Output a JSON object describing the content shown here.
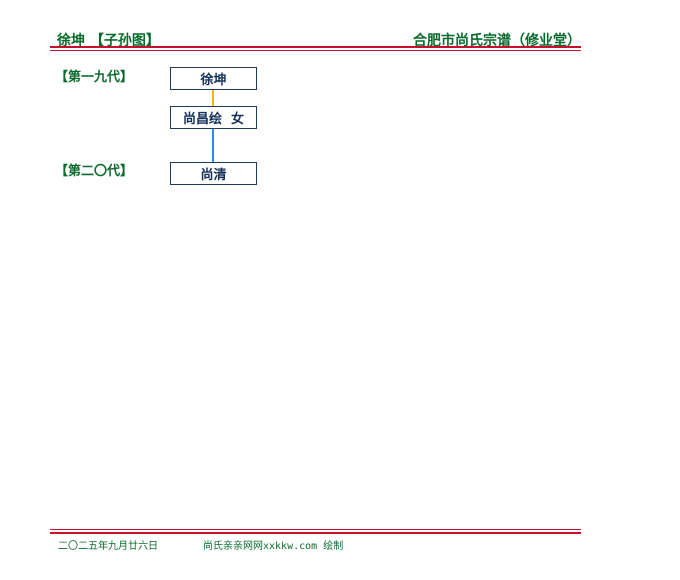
{
  "header": {
    "left_title": "徐坤 【子孙图】",
    "right_title": "合肥市尚氏宗谱（修业堂）"
  },
  "generations": [
    {
      "label": "【第一九代】"
    },
    {
      "label": "【第二〇代】"
    }
  ],
  "persons": [
    {
      "name": "徐坤"
    },
    {
      "name": "尚昌绘  女"
    },
    {
      "name": "尚清"
    }
  ],
  "colors": {
    "header_text": "#0b6b2e",
    "rule": "#c8102e",
    "box_border": "#1b3a5c",
    "spouse_link": "#f2b705",
    "child_link": "#1e90ff"
  },
  "footer": {
    "date": "二〇二五年九月廿六日",
    "credit": "尚氏亲亲网网xxkkw.com 绘制"
  }
}
